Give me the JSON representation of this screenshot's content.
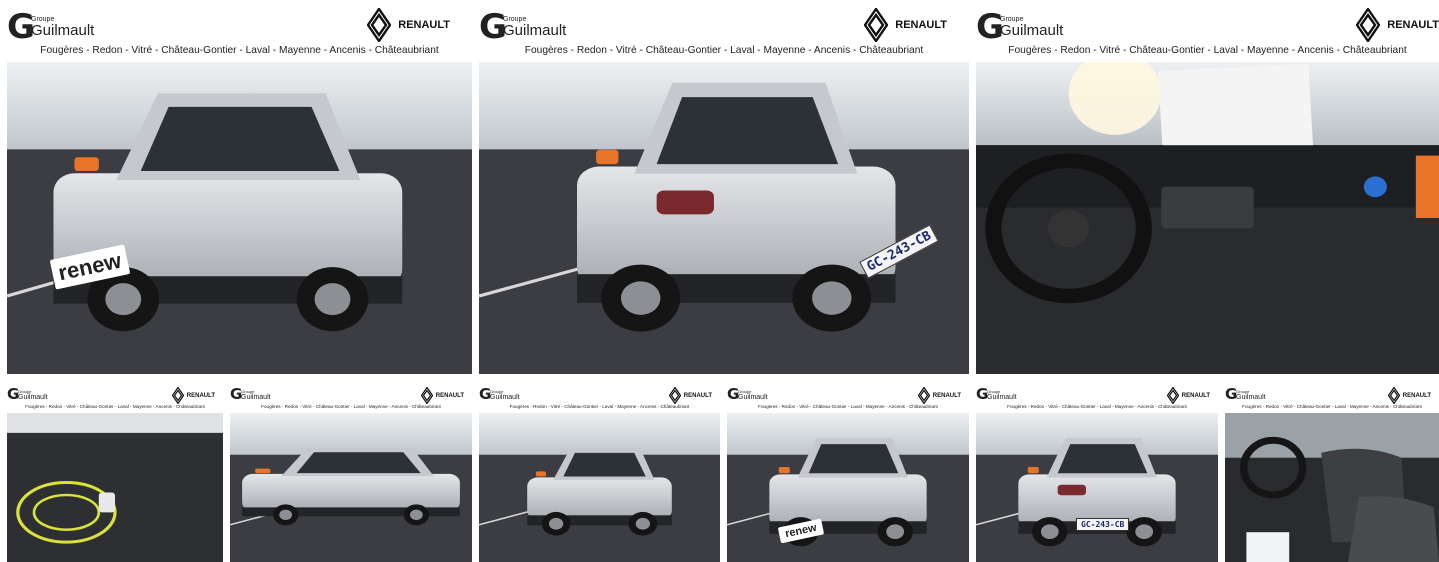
{
  "gallery": {
    "tiles": [
      {
        "brand_small": "Groupe",
        "brand": "Guilmault",
        "dealer": "RENAULT",
        "cities": "Fougères - Redon - Vitré - Château-Gontier - Laval - Mayenne - Ancenis - Châteaubriant",
        "plate": "",
        "sticker": "renew",
        "scene": "front-34"
      },
      {
        "brand_small": "Groupe",
        "brand": "Guilmault",
        "dealer": "RENAULT",
        "cities": "Fougères - Redon - Vitré - Château-Gontier - Laval - Mayenne - Ancenis - Châteaubriant",
        "plate": "GC-243-CB",
        "sticker": "",
        "scene": "rear-34"
      },
      {
        "brand_small": "Groupe",
        "brand": "Guilmault",
        "dealer": "RENAULT",
        "cities": "Fougères - Redon - Vitré - Château-Gontier - Laval - Mayenne - Ancenis - Châteaubriant",
        "plate": "",
        "sticker": "",
        "scene": "dashboard"
      },
      {
        "brand_small": "Groupe",
        "brand": "Guilmault",
        "dealer": "RENAULT",
        "cities": "Fougères - Redon - Vitré - Château-Gontier - Laval - Mayenne - Ancenis - Châteaubriant",
        "plate": "",
        "sticker": "",
        "scene": "trunk"
      },
      {
        "brand_small": "Groupe",
        "brand": "Guilmault",
        "dealer": "RENAULT",
        "cities": "Fougères - Redon - Vitré - Château-Gontier - Laval - Mayenne - Ancenis - Châteaubriant",
        "plate": "",
        "sticker": "",
        "scene": "side"
      },
      {
        "brand_small": "Groupe",
        "brand": "Guilmault",
        "dealer": "RENAULT",
        "cities": "Fougères - Redon - Vitré - Château-Gontier - Laval - Mayenne - Ancenis - Châteaubriant",
        "plate": "",
        "sticker": "",
        "scene": "front-34-small"
      },
      {
        "brand_small": "Groupe",
        "brand": "Guilmault",
        "dealer": "RENAULT",
        "cities": "Fougères - Redon - Vitré - Château-Gontier - Laval - Mayenne - Ancenis - Châteaubriant",
        "plate": "",
        "sticker": "renew",
        "scene": "front"
      },
      {
        "brand_small": "Groupe",
        "brand": "Guilmault",
        "dealer": "RENAULT",
        "cities": "Fougères - Redon - Vitré - Château-Gontier - Laval - Mayenne - Ancenis - Châteaubriant",
        "plate": "GC-243-CB",
        "sticker": "",
        "scene": "rear"
      },
      {
        "brand_small": "Groupe",
        "brand": "Guilmault",
        "dealer": "RENAULT",
        "cities": "Fougères - Redon - Vitré - Château-Gontier - Laval - Mayenne - Ancenis - Châteaubriant",
        "plate": "",
        "sticker": "",
        "scene": "seats"
      }
    ]
  },
  "colors": {
    "body_silver": "#c9cbcf",
    "accent_orange": "#e8742a",
    "asphalt": "#3b3d42",
    "sky": "#d9dde0"
  }
}
